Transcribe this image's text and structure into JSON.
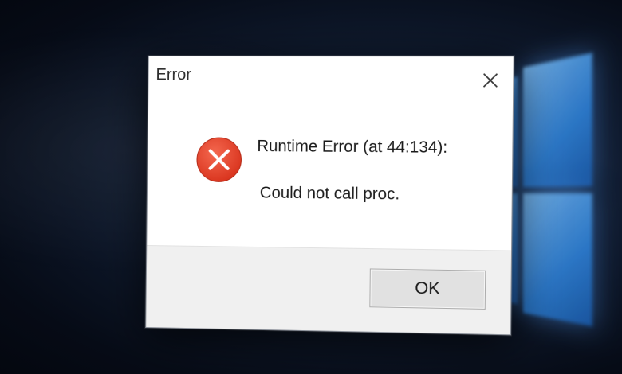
{
  "dialog": {
    "title": "Error",
    "close_icon": "close-icon",
    "icon": "error-icon",
    "message_line_1": "Runtime Error (at 44:134):",
    "message_line_2": "Could not call proc.",
    "ok_label": "OK"
  },
  "colors": {
    "error_red": "#e8412c",
    "background": "#0f1a2e",
    "accent_blue": "#2f86e0",
    "footer": "#f0f0f0"
  }
}
